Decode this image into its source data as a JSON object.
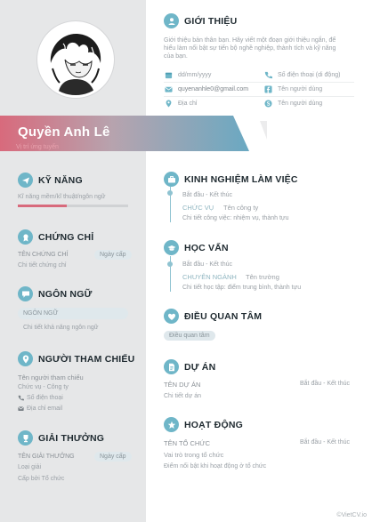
{
  "profile": {
    "name": "Quyền Anh Lê",
    "position_placeholder": "Vị trí ứng tuyển"
  },
  "intro": {
    "title": "GIỚI THIỆU",
    "text_line1": "Giới thiệu bản thân bạn. Hãy viết một đoạn giới thiệu ngắn, để",
    "text_line2": "hiểu làm nổi bật sự tiến bộ nghề nghiệp, thành tích và kỹ năng",
    "text_line3": "của bạn."
  },
  "contact": {
    "birthday": "dd/mm/yyyy",
    "phone": "Số điện thoại (di động)",
    "email": "quyenanhle0@gmail.com",
    "facebook": "Tên người dùng",
    "address": "Địa chỉ",
    "skype": "Tên người dùng"
  },
  "skills": {
    "title": "KỸ NĂNG",
    "item": "Kĩ năng mềm/kĩ thuật/ngôn ngữ",
    "level": 0.44
  },
  "certificates": {
    "title": "CHỨNG CHỈ",
    "name": "TÊN CHỨNG CHỈ",
    "date": "Ngày cấp",
    "detail": "Chi tiết chứng chỉ"
  },
  "languages": {
    "title": "NGÔN NGỮ",
    "name": "NGÔN NGỮ",
    "detail": "Chi tiết khả năng ngôn ngữ"
  },
  "references": {
    "title": "NGƯỜI THAM CHIẾU",
    "name": "Tên người tham chiếu",
    "role": "Chức vụ - Công ty",
    "phone": "Số điện thoại",
    "email": "Địa chỉ email"
  },
  "awards": {
    "title": "GIẢI THƯỞNG",
    "name": "TÊN GIẢI THƯỞNG",
    "date": "Ngày cấp",
    "type": "Loại giải",
    "issuer": "Cấp bởi Tổ chức"
  },
  "experience": {
    "title": "KINH NGHIỆM LÀM VIỆC",
    "period": "Bắt đầu - Kết thúc",
    "role": "CHỨC VỤ",
    "company": "Tên công ty",
    "detail": "Chi tiết công việc: nhiệm vụ, thành tựu"
  },
  "education": {
    "title": "HỌC VẤN",
    "period": "Bắt đầu - Kết thúc",
    "major": "CHUYÊN NGÀNH",
    "school": "Tên trường",
    "detail": "Chi tiết học tập: điểm trung bình, thành tựu"
  },
  "interests": {
    "title": "ĐIỀU QUAN TÂM",
    "item": "Điều quan tâm"
  },
  "projects": {
    "title": "DỰ ÁN",
    "name": "TÊN DỰ ÁN",
    "period": "Bắt đầu - Kết thúc",
    "detail": "Chi tiết dự án"
  },
  "activities": {
    "title": "HOẠT ĐỘNG",
    "name": "TÊN TỔ CHỨC",
    "period": "Bắt đầu - Kết thúc",
    "role": "Vai trò trong tổ chức",
    "detail": "Điểm nổi bật khi hoạt động ở tổ chức"
  },
  "footer": {
    "brand": "©VietCV.io"
  },
  "colors": {
    "accent": "#6fb6c8",
    "banner_start": "#d86a7c",
    "banner_end": "#6aa9c2",
    "sidebar": "#e6e7e8"
  }
}
